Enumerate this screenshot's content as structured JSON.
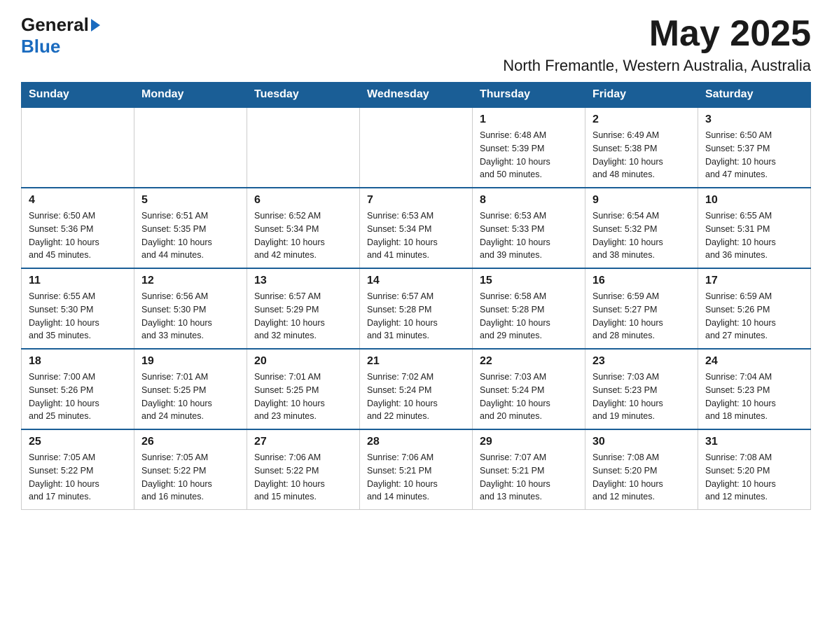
{
  "header": {
    "logo_general": "General",
    "logo_blue": "Blue",
    "month_year": "May 2025",
    "location": "North Fremantle, Western Australia, Australia"
  },
  "weekdays": [
    "Sunday",
    "Monday",
    "Tuesday",
    "Wednesday",
    "Thursday",
    "Friday",
    "Saturday"
  ],
  "weeks": [
    {
      "days": [
        {
          "number": "",
          "info": ""
        },
        {
          "number": "",
          "info": ""
        },
        {
          "number": "",
          "info": ""
        },
        {
          "number": "",
          "info": ""
        },
        {
          "number": "1",
          "info": "Sunrise: 6:48 AM\nSunset: 5:39 PM\nDaylight: 10 hours\nand 50 minutes."
        },
        {
          "number": "2",
          "info": "Sunrise: 6:49 AM\nSunset: 5:38 PM\nDaylight: 10 hours\nand 48 minutes."
        },
        {
          "number": "3",
          "info": "Sunrise: 6:50 AM\nSunset: 5:37 PM\nDaylight: 10 hours\nand 47 minutes."
        }
      ]
    },
    {
      "days": [
        {
          "number": "4",
          "info": "Sunrise: 6:50 AM\nSunset: 5:36 PM\nDaylight: 10 hours\nand 45 minutes."
        },
        {
          "number": "5",
          "info": "Sunrise: 6:51 AM\nSunset: 5:35 PM\nDaylight: 10 hours\nand 44 minutes."
        },
        {
          "number": "6",
          "info": "Sunrise: 6:52 AM\nSunset: 5:34 PM\nDaylight: 10 hours\nand 42 minutes."
        },
        {
          "number": "7",
          "info": "Sunrise: 6:53 AM\nSunset: 5:34 PM\nDaylight: 10 hours\nand 41 minutes."
        },
        {
          "number": "8",
          "info": "Sunrise: 6:53 AM\nSunset: 5:33 PM\nDaylight: 10 hours\nand 39 minutes."
        },
        {
          "number": "9",
          "info": "Sunrise: 6:54 AM\nSunset: 5:32 PM\nDaylight: 10 hours\nand 38 minutes."
        },
        {
          "number": "10",
          "info": "Sunrise: 6:55 AM\nSunset: 5:31 PM\nDaylight: 10 hours\nand 36 minutes."
        }
      ]
    },
    {
      "days": [
        {
          "number": "11",
          "info": "Sunrise: 6:55 AM\nSunset: 5:30 PM\nDaylight: 10 hours\nand 35 minutes."
        },
        {
          "number": "12",
          "info": "Sunrise: 6:56 AM\nSunset: 5:30 PM\nDaylight: 10 hours\nand 33 minutes."
        },
        {
          "number": "13",
          "info": "Sunrise: 6:57 AM\nSunset: 5:29 PM\nDaylight: 10 hours\nand 32 minutes."
        },
        {
          "number": "14",
          "info": "Sunrise: 6:57 AM\nSunset: 5:28 PM\nDaylight: 10 hours\nand 31 minutes."
        },
        {
          "number": "15",
          "info": "Sunrise: 6:58 AM\nSunset: 5:28 PM\nDaylight: 10 hours\nand 29 minutes."
        },
        {
          "number": "16",
          "info": "Sunrise: 6:59 AM\nSunset: 5:27 PM\nDaylight: 10 hours\nand 28 minutes."
        },
        {
          "number": "17",
          "info": "Sunrise: 6:59 AM\nSunset: 5:26 PM\nDaylight: 10 hours\nand 27 minutes."
        }
      ]
    },
    {
      "days": [
        {
          "number": "18",
          "info": "Sunrise: 7:00 AM\nSunset: 5:26 PM\nDaylight: 10 hours\nand 25 minutes."
        },
        {
          "number": "19",
          "info": "Sunrise: 7:01 AM\nSunset: 5:25 PM\nDaylight: 10 hours\nand 24 minutes."
        },
        {
          "number": "20",
          "info": "Sunrise: 7:01 AM\nSunset: 5:25 PM\nDaylight: 10 hours\nand 23 minutes."
        },
        {
          "number": "21",
          "info": "Sunrise: 7:02 AM\nSunset: 5:24 PM\nDaylight: 10 hours\nand 22 minutes."
        },
        {
          "number": "22",
          "info": "Sunrise: 7:03 AM\nSunset: 5:24 PM\nDaylight: 10 hours\nand 20 minutes."
        },
        {
          "number": "23",
          "info": "Sunrise: 7:03 AM\nSunset: 5:23 PM\nDaylight: 10 hours\nand 19 minutes."
        },
        {
          "number": "24",
          "info": "Sunrise: 7:04 AM\nSunset: 5:23 PM\nDaylight: 10 hours\nand 18 minutes."
        }
      ]
    },
    {
      "days": [
        {
          "number": "25",
          "info": "Sunrise: 7:05 AM\nSunset: 5:22 PM\nDaylight: 10 hours\nand 17 minutes."
        },
        {
          "number": "26",
          "info": "Sunrise: 7:05 AM\nSunset: 5:22 PM\nDaylight: 10 hours\nand 16 minutes."
        },
        {
          "number": "27",
          "info": "Sunrise: 7:06 AM\nSunset: 5:22 PM\nDaylight: 10 hours\nand 15 minutes."
        },
        {
          "number": "28",
          "info": "Sunrise: 7:06 AM\nSunset: 5:21 PM\nDaylight: 10 hours\nand 14 minutes."
        },
        {
          "number": "29",
          "info": "Sunrise: 7:07 AM\nSunset: 5:21 PM\nDaylight: 10 hours\nand 13 minutes."
        },
        {
          "number": "30",
          "info": "Sunrise: 7:08 AM\nSunset: 5:20 PM\nDaylight: 10 hours\nand 12 minutes."
        },
        {
          "number": "31",
          "info": "Sunrise: 7:08 AM\nSunset: 5:20 PM\nDaylight: 10 hours\nand 12 minutes."
        }
      ]
    }
  ]
}
